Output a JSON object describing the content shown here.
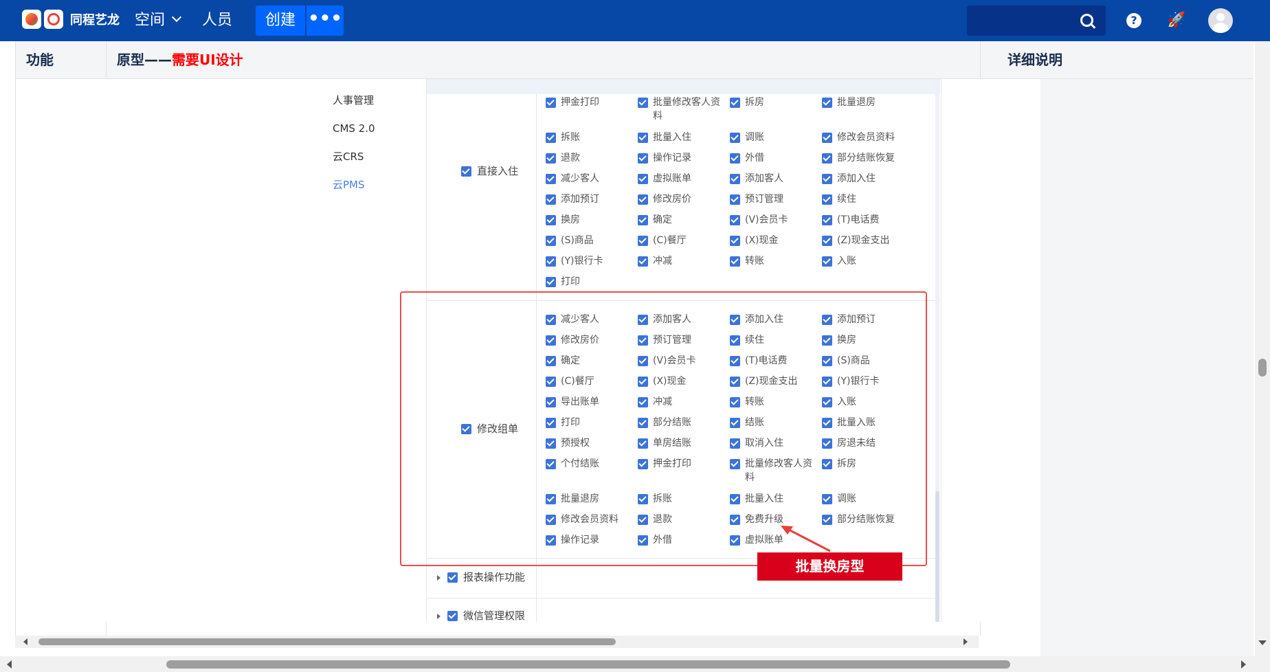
{
  "nav": {
    "logo_text": "同程艺龙",
    "spaces": "空间",
    "people": "人员",
    "create": "创建",
    "more": "•••",
    "help": "?",
    "notify": "🚀"
  },
  "table": {
    "col_function": "功能",
    "col_prototype_prefix": "原型——",
    "col_prototype_highlight": "需要UI设计",
    "col_detail": "详细说明"
  },
  "side_menu": [
    "人事管理",
    "CMS 2.0",
    "云CRS",
    "云PMS"
  ],
  "group1": {
    "label": "直接入住",
    "items": [
      "押金打印",
      "批量修改客人资料",
      "拆房",
      "批量退房",
      "拆账",
      "批量入住",
      "调账",
      "修改会员资料",
      "退款",
      "操作记录",
      "外借",
      "部分结账恢复",
      "减少客人",
      "虚拟账单",
      "添加客人",
      "添加入住",
      "添加预订",
      "修改房价",
      "预订管理",
      "续住",
      "换房",
      "确定",
      "(V)会员卡",
      "(T)电话费",
      "(S)商品",
      "(C)餐厅",
      "(X)现金",
      "(Z)现金支出",
      "(Y)银行卡",
      "冲减",
      "转账",
      "入账",
      "打印"
    ]
  },
  "group2": {
    "label": "修改组单",
    "items": [
      "减少客人",
      "添加客人",
      "添加入住",
      "添加预订",
      "修改房价",
      "预订管理",
      "续住",
      "换房",
      "确定",
      "(V)会员卡",
      "(T)电话费",
      "(S)商品",
      "(C)餐厅",
      "(X)现金",
      "(Z)现金支出",
      "(Y)银行卡",
      "导出账单",
      "冲减",
      "转账",
      "入账",
      "打印",
      "部分结账",
      "结账",
      "批量入账",
      "预授权",
      "单房结账",
      "取消入住",
      "房退未结",
      "个付结账",
      "押金打印",
      "批量修改客人资料",
      "拆房",
      "批量退房",
      "拆账",
      "批量入住",
      "调账",
      "修改会员资料",
      "退款",
      "免费升级",
      "部分结账恢复",
      "操作记录",
      "外借",
      "虚拟账单"
    ]
  },
  "group3": {
    "label": "报表操作功能"
  },
  "group4": {
    "label": "微信管理权限"
  },
  "annotation": "批量换房型"
}
